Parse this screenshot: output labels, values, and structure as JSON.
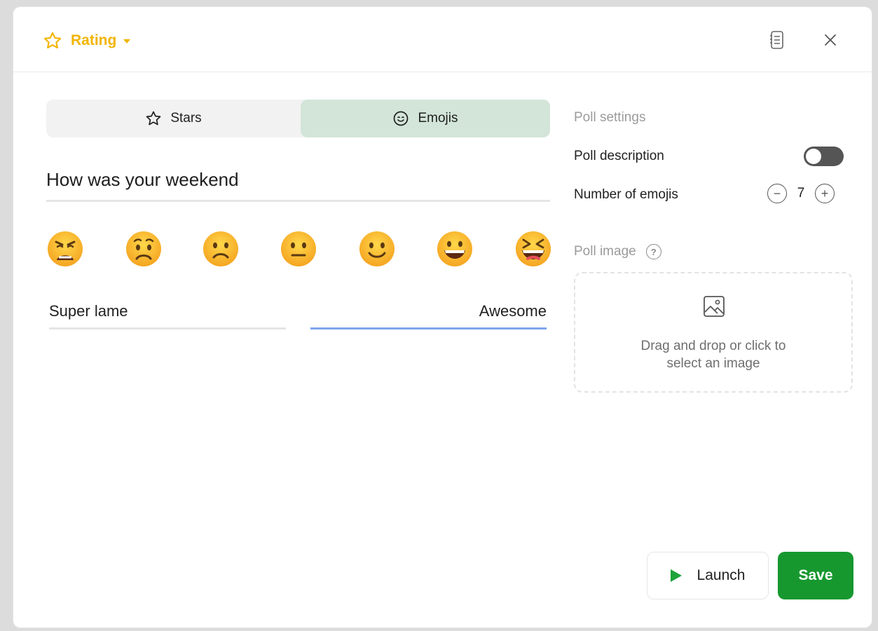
{
  "header": {
    "poll_type_label": "Rating",
    "poll_type_icon": "star-outline-icon",
    "notes_icon": "notes-icon",
    "close_icon": "close-icon"
  },
  "rating_style": {
    "options": [
      {
        "label": "Stars",
        "icon": "star-outline-icon",
        "selected": false
      },
      {
        "label": "Emojis",
        "icon": "smiley-icon",
        "selected": true
      }
    ]
  },
  "question": {
    "text": "How was your weekend"
  },
  "emojis": [
    "weary-face",
    "worried-face",
    "slightly-frowning-face",
    "neutral-face",
    "slightly-smiling-face",
    "grinning-face",
    "laughing-face"
  ],
  "scale": {
    "low_label": "Super lame",
    "high_label": "Awesome"
  },
  "settings": {
    "title": "Poll settings",
    "description_label": "Poll description",
    "description_enabled": false,
    "emoji_count_label": "Number of emojis",
    "emoji_count": "7",
    "decrement_symbol": "−",
    "increment_symbol": "+",
    "image_label": "Poll image",
    "help_symbol": "?",
    "dropzone_line1": "Drag and drop or click to",
    "dropzone_line2": "select an image"
  },
  "footer": {
    "launch_label": "Launch",
    "save_label": "Save"
  },
  "colors": {
    "accent": "#f2b400",
    "selected_segment": "#d2e5d8",
    "save_button": "#16982f",
    "active_underline": "#7ea6ee"
  }
}
